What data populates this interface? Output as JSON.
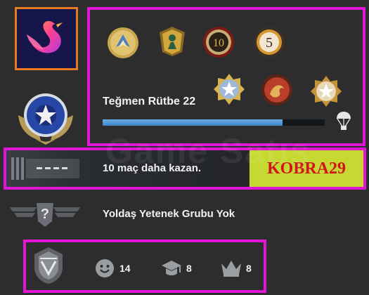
{
  "profile": {
    "avatar_icon": "pink-swan-avatar-icon",
    "avatar_border_color": "#e87a22",
    "rank_emblem_icon": "star-rank-emblem-icon"
  },
  "medals": [
    {
      "icon": "operation-coin-icon"
    },
    {
      "icon": "gold-soldier-medal-icon"
    },
    {
      "icon": "10-year-coin-icon"
    },
    {
      "icon": "5-year-coin-icon"
    },
    {
      "icon": "service-medal-blue-star-icon"
    },
    {
      "icon": "dragon-coin-icon"
    },
    {
      "icon": "service-medal-gold-star-icon"
    }
  ],
  "rank": {
    "title": "Teğmen Rütbe 22",
    "xp_progress": 0.81,
    "xp_color": "#4a95d8",
    "drop_icon": "parachute-drop-icon"
  },
  "competitive": {
    "wins_text": "10 maç daha kazan.",
    "promo_code": "KOBRA29",
    "promo_bg_color": "#c6d933",
    "promo_text_color": "#d0161b"
  },
  "wingman": {
    "text": "Yoldaş Yetenek Grubu Yok",
    "icon": "unknown-wingman-rank-icon"
  },
  "commendations": {
    "badge_icon": "danger-zone-badge-icon",
    "friendly_icon": "smiley-icon",
    "friendly": "14",
    "teacher_icon": "graduation-cap-icon",
    "teacher": "8",
    "leader_icon": "crown-icon",
    "leader": "8"
  },
  "watermark": "Game Satış",
  "highlight_color": "#e015d6"
}
